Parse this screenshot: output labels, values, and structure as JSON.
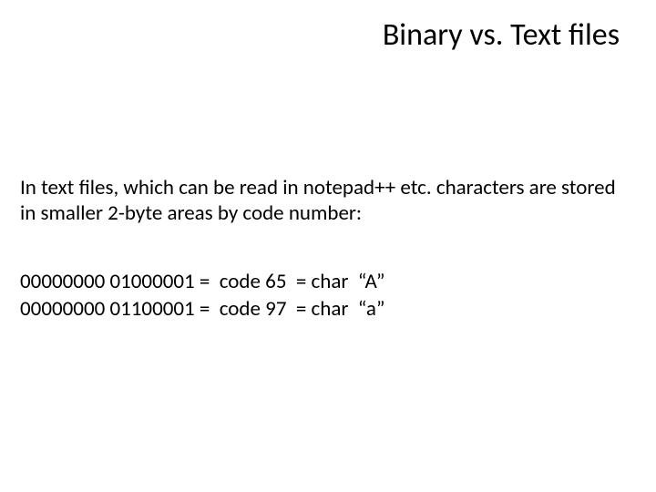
{
  "title": "Binary vs. Text files",
  "body": "In text files, which can be read in notepad++ etc. characters are stored in smaller 2-byte areas by code number:",
  "examples": [
    "00000000 01000001 =  code 65  = char  “A”",
    "00000000 01100001 =  code 97  = char  “a”"
  ]
}
